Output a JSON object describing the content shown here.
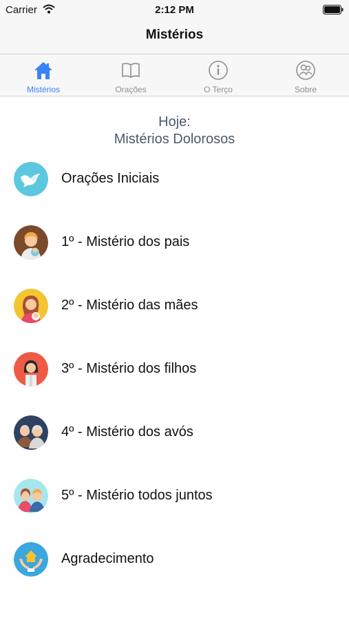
{
  "status_bar": {
    "carrier": "Carrier",
    "time": "2:12 PM"
  },
  "nav": {
    "title": "Mistérios"
  },
  "tabs": [
    {
      "label": "Mistérios",
      "icon": "home-icon",
      "active": true
    },
    {
      "label": "Orações",
      "icon": "book-icon",
      "active": false
    },
    {
      "label": "O Terço",
      "icon": "info-icon",
      "active": false
    },
    {
      "label": "Sobre",
      "icon": "people-icon",
      "active": false
    }
  ],
  "today": {
    "label": "Hoje:",
    "mystery": "Mistérios Dolorosos"
  },
  "items": [
    {
      "label": "Orações Iniciais",
      "icon": "dove-icon",
      "color": "#5bc8dd"
    },
    {
      "label": "1º - Mistério dos pais",
      "icon": "father-baby-icon",
      "color": "#7a4a2a"
    },
    {
      "label": "2º - Mistério das mães",
      "icon": "mother-baby-icon",
      "color": "#f5c431"
    },
    {
      "label": "3º - Mistério dos filhos",
      "icon": "child-icon",
      "color": "#ef5a45"
    },
    {
      "label": "4º - Mistério dos avós",
      "icon": "grandparents-icon",
      "color": "#2f4360"
    },
    {
      "label": "5º - Mistério todos juntos",
      "icon": "family-icon",
      "color": "#a6e6ef"
    },
    {
      "label": "Agradecimento",
      "icon": "hands-house-icon",
      "color": "#3aa7e0"
    }
  ],
  "colors": {
    "accent": "#3a82f7",
    "tab_inactive": "#8e8e93",
    "header_text": "#4a5a6a"
  }
}
